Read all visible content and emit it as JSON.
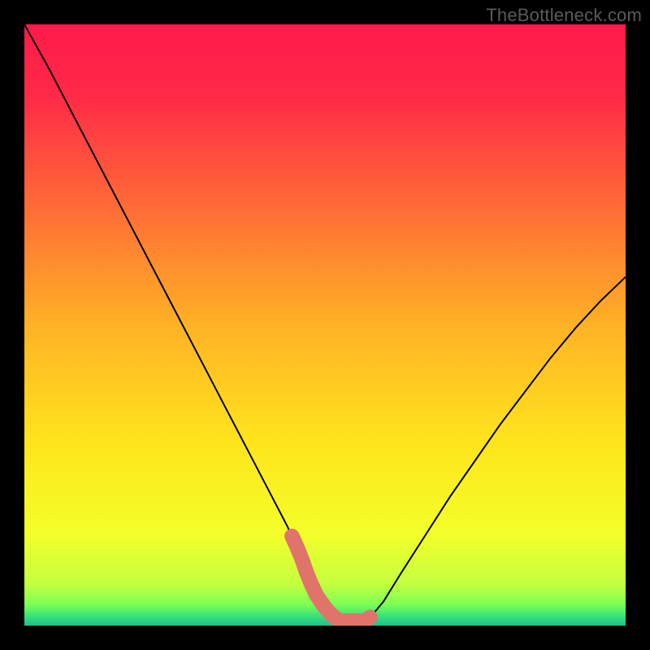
{
  "watermark": "TheBottleneck.com",
  "chart_data": {
    "type": "line",
    "title": "",
    "xlabel": "",
    "ylabel": "",
    "xlim": [
      0,
      100
    ],
    "ylim": [
      0,
      100
    ],
    "curve": {
      "name": "bottleneck-curve",
      "color": "#000000",
      "x": [
        0.0,
        4.17,
        8.33,
        12.5,
        16.67,
        20.83,
        25.0,
        29.17,
        33.33,
        37.5,
        41.67,
        43.75,
        45.83,
        47.22,
        48.61,
        50.0,
        51.39,
        52.78,
        54.17,
        55.56,
        56.25,
        57.64,
        59.72,
        62.5,
        66.67,
        70.83,
        75.0,
        79.17,
        83.33,
        87.5,
        91.67,
        95.83,
        100.0
      ],
      "y": [
        100.0,
        92.5,
        84.5,
        76.5,
        68.5,
        60.5,
        52.5,
        44.5,
        36.5,
        28.5,
        20.5,
        16.5,
        12.0,
        8.0,
        5.0,
        3.0,
        1.5,
        0.6,
        0.2,
        0.2,
        0.5,
        1.5,
        4.0,
        8.5,
        15.0,
        21.5,
        27.5,
        33.5,
        39.0,
        44.5,
        49.5,
        54.0,
        58.0
      ]
    },
    "flat_bottom_band": {
      "name": "optimal-range-marker",
      "color": "#e0746a",
      "x_start": 44.5,
      "x_end": 57.5,
      "y_level": 0.8,
      "thickness": 2.5
    },
    "gradient_stops": [
      {
        "offset": 0.0,
        "color": "#ff1a4a"
      },
      {
        "offset": 0.12,
        "color": "#ff2a47"
      },
      {
        "offset": 0.3,
        "color": "#ff6a36"
      },
      {
        "offset": 0.5,
        "color": "#ffb225"
      },
      {
        "offset": 0.7,
        "color": "#ffe61c"
      },
      {
        "offset": 0.85,
        "color": "#f3ff2a"
      },
      {
        "offset": 0.93,
        "color": "#c4ff3f"
      },
      {
        "offset": 0.965,
        "color": "#7dff55"
      },
      {
        "offset": 0.985,
        "color": "#35e07a"
      },
      {
        "offset": 1.0,
        "color": "#1fbf8f"
      }
    ]
  }
}
